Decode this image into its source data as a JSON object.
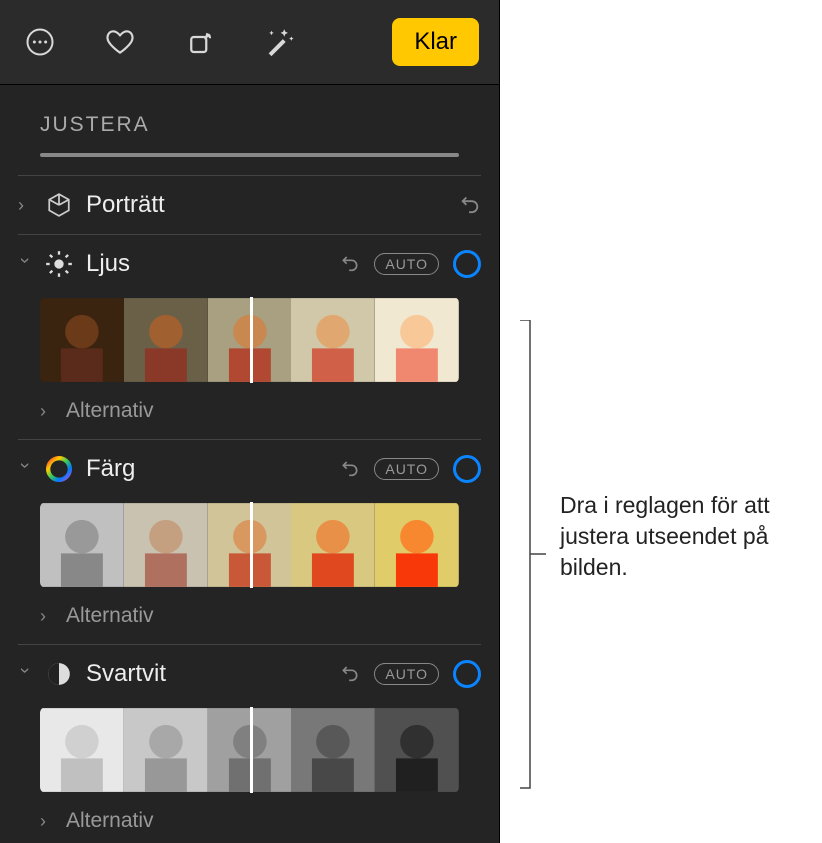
{
  "toolbar": {
    "done_label": "Klar"
  },
  "section": {
    "title": "JUSTERA"
  },
  "rows": {
    "portrait": {
      "label": "Porträtt"
    },
    "light": {
      "label": "Ljus",
      "auto": "AUTO",
      "options": "Alternativ"
    },
    "color": {
      "label": "Färg",
      "auto": "AUTO",
      "options": "Alternativ"
    },
    "bw": {
      "label": "Svartvit",
      "auto": "AUTO",
      "options": "Alternativ"
    }
  },
  "callout": {
    "text": "Dra i reglagen för att justera utseendet på bilden."
  }
}
